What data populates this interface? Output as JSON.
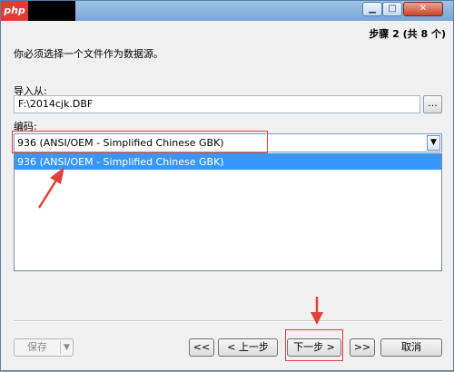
{
  "titlebar": {
    "logo_text": "php",
    "min_glyph": "▁",
    "max_glyph": "□",
    "close_glyph": "✕"
  },
  "step_label": "步骤 2 (共 8 个)",
  "description": "你必须选择一个文件作为数据源。",
  "import": {
    "label": "导入从:",
    "value": "F:\\2014cjk.DBF",
    "browse_label": "..."
  },
  "encoding": {
    "label": "编码:",
    "value": "936 (ANSI/OEM - Simplified Chinese GBK)",
    "options": [
      "936 (ANSI/OEM - Simplified Chinese GBK)"
    ]
  },
  "footer": {
    "save_label": "保存",
    "first_label": "<<",
    "prev_label": "< 上一步",
    "next_label": "下一步 >",
    "last_label": ">>",
    "cancel_label": "取消"
  },
  "annotations": {
    "highlight_color": "#e0403a"
  }
}
